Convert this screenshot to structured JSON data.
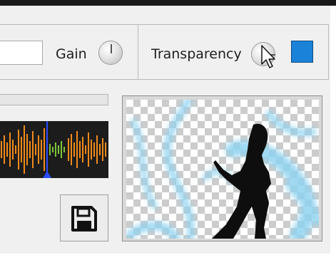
{
  "toolbar": {
    "gain_label": "Gain",
    "transparency_label": "Transparency",
    "transparency_color": "#1a82d9",
    "input_value": ""
  },
  "save_icon": "floppy-disk-icon",
  "colors": {
    "waveform_bg": "#1c1c1c",
    "waveform_orange": "#f08a1c",
    "waveform_green": "#7ec43a",
    "playhead": "#2a4cff",
    "smoke": "#8fd3f0"
  }
}
